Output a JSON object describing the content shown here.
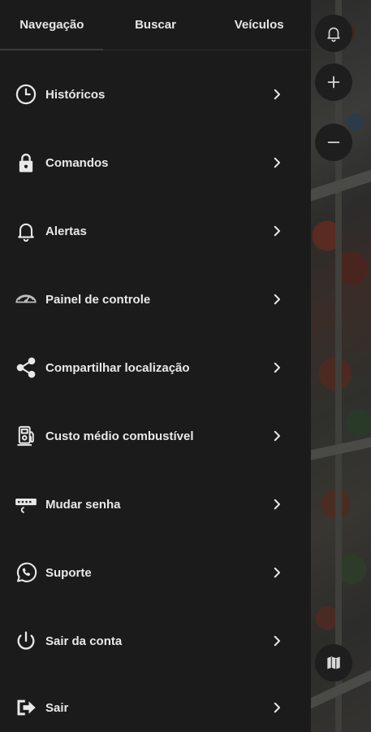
{
  "tabs": [
    {
      "label": "Navegação",
      "active": true
    },
    {
      "label": "Buscar",
      "active": false
    },
    {
      "label": "Veículos",
      "active": false
    }
  ],
  "menu": [
    {
      "label": "Históricos",
      "icon": "clock-icon"
    },
    {
      "label": "Comandos",
      "icon": "lock-icon"
    },
    {
      "label": "Alertas",
      "icon": "bell-icon"
    },
    {
      "label": "Painel de controle",
      "icon": "dashboard-icon"
    },
    {
      "label": "Compartilhar localização",
      "icon": "share-icon"
    },
    {
      "label": "Custo médio combustível",
      "icon": "fuel-pump-icon"
    },
    {
      "label": "Mudar senha",
      "icon": "password-icon"
    },
    {
      "label": "Suporte",
      "icon": "whatsapp-icon"
    },
    {
      "label": "Sair da conta",
      "icon": "power-icon"
    },
    {
      "label": "Sair",
      "icon": "exit-icon"
    }
  ],
  "colors": {
    "drawer_bg": "#1b1b1b",
    "text": "#e8e8e8",
    "map_button_bg": "#1e1e1e"
  }
}
